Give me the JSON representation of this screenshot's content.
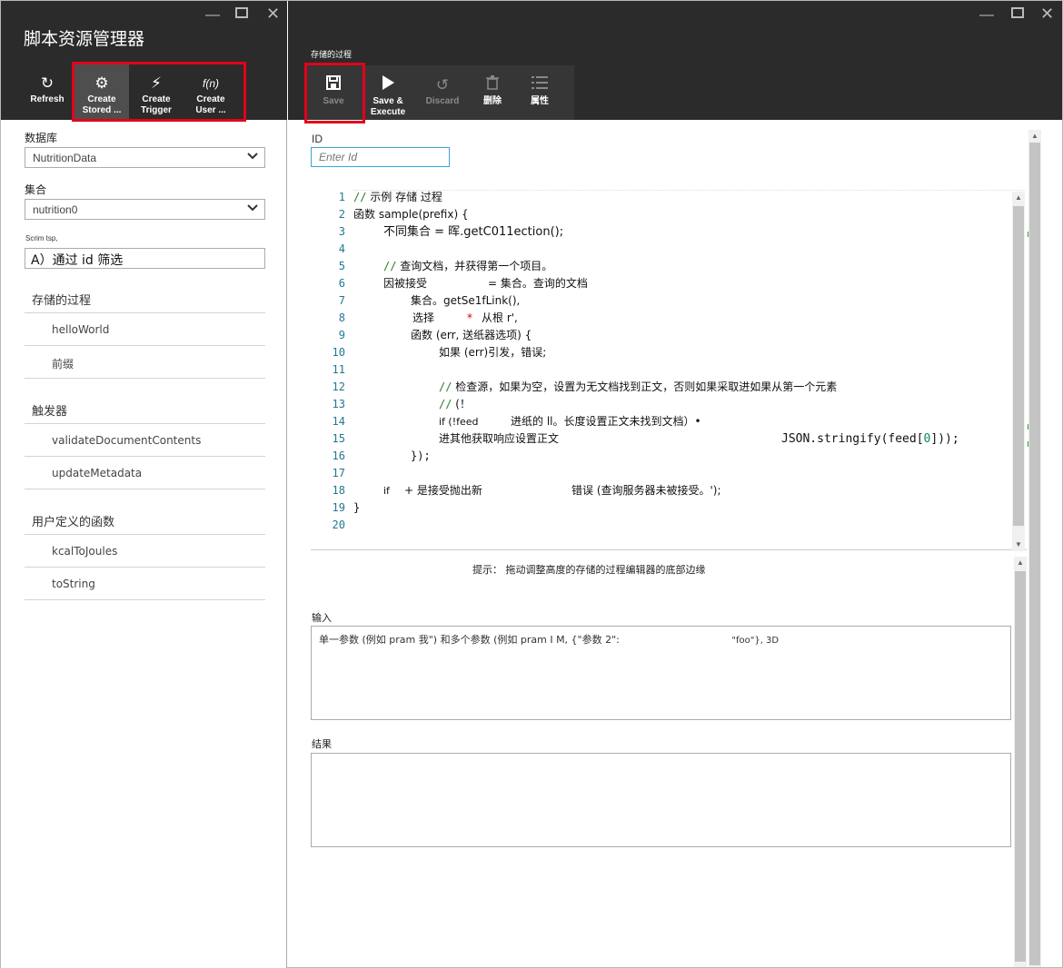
{
  "left_blade": {
    "title": "脚本资源管理器",
    "toolbar": {
      "refresh_label": "Refresh",
      "create_stored_label_1": "Create",
      "create_stored_label_2": "Stored ...",
      "create_trigger_label_1": "Create",
      "create_trigger_label_2": "Trigger",
      "create_udf_label_1": "Create",
      "create_udf_label_2": "User ...",
      "udf_icon_text": "f(n)"
    },
    "database_label": "数据库",
    "database_value": "NutritionData",
    "collection_label": "集合",
    "collection_value": "nutrition0",
    "filter_label": "Scrim tsp,",
    "filter_value": "A）通过 id 筛选",
    "sections": {
      "stored_procs": {
        "title": "存储的过程",
        "items": [
          "helloWorld",
          "前缀"
        ]
      },
      "triggers": {
        "title": "触发器",
        "items": [
          "validateDocumentContents",
          "updateMetadata"
        ]
      },
      "udfs": {
        "title": "用户定义的函数",
        "items": [
          "kcalToJoules",
          "toString"
        ]
      }
    }
  },
  "right_blade": {
    "title": "存储的过程",
    "toolbar": {
      "save_label": "Save",
      "save_execute_label_1": "Save &",
      "save_execute_label_2": "Execute",
      "discard_label": "Discard",
      "delete_label": "删除",
      "properties_label": "属性"
    },
    "id_label": "ID",
    "id_placeholder": "Enter Id",
    "code": {
      "line_numbers": [
        "1",
        "2",
        "3",
        "4",
        "5",
        "6",
        "7",
        "8",
        "9",
        "10",
        "11",
        "12",
        "13",
        "14",
        "15",
        "16",
        "17",
        "18",
        "19",
        "20"
      ],
      "l1": "示例       存储       过程",
      "l1_comment": "//",
      "l2": "函数 sample(prefix) {",
      "l3": "不同集合 = 晖.getC011ection();",
      "l5_comment": "//",
      "l5": "查询文档，并获得第一个项目。",
      "l6a": "因被接受",
      "l6b": "= 集合。查询的文档",
      "l7": "集合。getSe1fLink(),",
      "l8a": "选择",
      "l8star": "*",
      "l8b": "从根 r',",
      "l9": "函数 (err, 送纸器选项) {",
      "l10": "如果 (err)引发，错误;",
      "l12_comment": "//",
      "l12": "检查源，如果为空，设置为无文档找到正文，否则如果采取进如果从第一个元素",
      "l13_comment": "//",
      "l13": "(！",
      "l14a": "if (!feed",
      "l14b": "进纸的 ll。长度设置正文未找到文档）•",
      "l15a": "进其他获取响应设置正文",
      "l15b": "JSON.stringify(feed[",
      "l15num": "0",
      "l15c": "]));",
      "l16": "});",
      "l18a": "if",
      "l18b": "+ 是接受抛出新",
      "l18c": "错误 (查询服务器未被接受。');",
      "l19": "}"
    },
    "hint": "提示：  拖动调整高度的存储的过程编辑器的底部边缘",
    "input_label": "输入",
    "input_value_a": "单一参数 (例如 pram 我\") 和多个参数 (例如 pram I M, {\"参数 2\":",
    "input_value_b": "\"foo\"}, 3D",
    "result_label": "结果",
    "result_value": ""
  }
}
